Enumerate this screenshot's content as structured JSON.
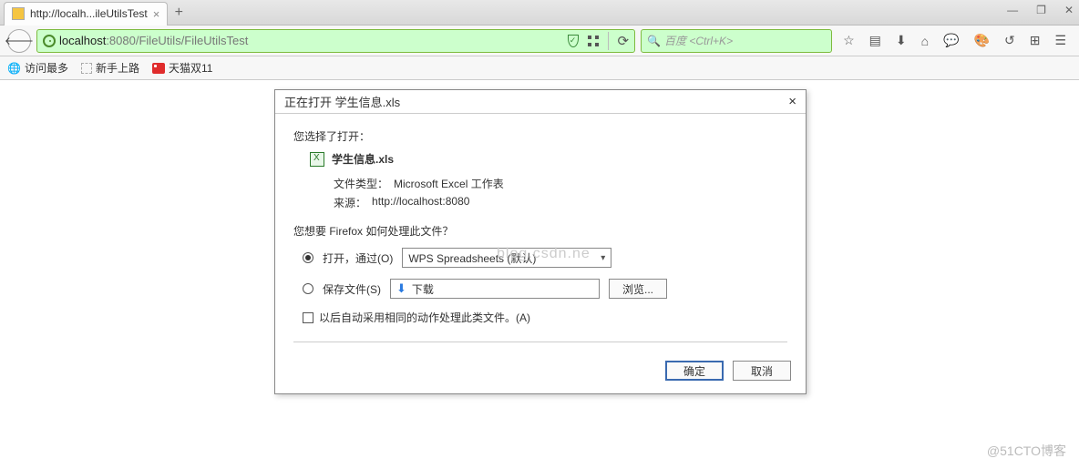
{
  "tab": {
    "title": "http://localh...ileUtilsTest"
  },
  "url": {
    "host": "localhost",
    "port": ":8080",
    "path": "/FileUtils/FileUtilsTest"
  },
  "search": {
    "placeholder": "百度 <Ctrl+K>"
  },
  "bookmarks": {
    "most_visited": "访问最多",
    "novice": "新手上路",
    "tmall": "天猫双11"
  },
  "dialog": {
    "title": "正在打开 学生信息.xls",
    "you_chose": "您选择了打开：",
    "filename": "学生信息.xls",
    "filetype_label": "文件类型：",
    "filetype_value": "Microsoft Excel 工作表",
    "source_label": "来源：",
    "source_value": "http://localhost:8080",
    "prompt": "您想要 Firefox 如何处理此文件？",
    "open_with_label": "打开，通过(O)",
    "open_with_app": "WPS Spreadsheets (默认)",
    "save_label": "保存文件(S)",
    "save_path": "下载",
    "browse": "浏览...",
    "remember": "以后自动采用相同的动作处理此类文件。(A)",
    "ok": "确定",
    "cancel": "取消"
  },
  "watermark": "@51CTO博客",
  "watermark2": "blog.csdn.ne"
}
